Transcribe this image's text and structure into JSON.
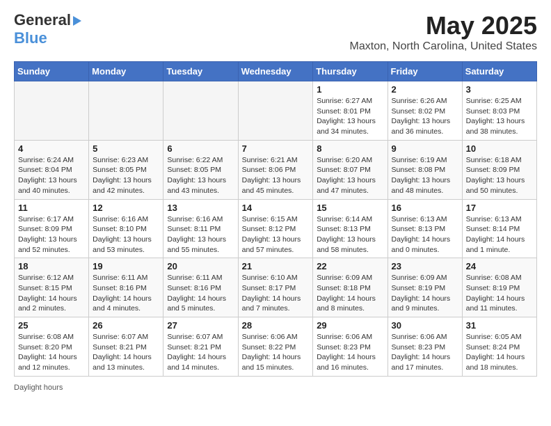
{
  "header": {
    "logo_line1": "General",
    "logo_line2": "Blue",
    "title": "May 2025",
    "location": "Maxton, North Carolina, United States"
  },
  "calendar": {
    "days_of_week": [
      "Sunday",
      "Monday",
      "Tuesday",
      "Wednesday",
      "Thursday",
      "Friday",
      "Saturday"
    ],
    "weeks": [
      [
        {
          "day": "",
          "detail": ""
        },
        {
          "day": "",
          "detail": ""
        },
        {
          "day": "",
          "detail": ""
        },
        {
          "day": "",
          "detail": ""
        },
        {
          "day": "1",
          "detail": "Sunrise: 6:27 AM\nSunset: 8:01 PM\nDaylight: 13 hours\nand 34 minutes."
        },
        {
          "day": "2",
          "detail": "Sunrise: 6:26 AM\nSunset: 8:02 PM\nDaylight: 13 hours\nand 36 minutes."
        },
        {
          "day": "3",
          "detail": "Sunrise: 6:25 AM\nSunset: 8:03 PM\nDaylight: 13 hours\nand 38 minutes."
        }
      ],
      [
        {
          "day": "4",
          "detail": "Sunrise: 6:24 AM\nSunset: 8:04 PM\nDaylight: 13 hours\nand 40 minutes."
        },
        {
          "day": "5",
          "detail": "Sunrise: 6:23 AM\nSunset: 8:05 PM\nDaylight: 13 hours\nand 42 minutes."
        },
        {
          "day": "6",
          "detail": "Sunrise: 6:22 AM\nSunset: 8:05 PM\nDaylight: 13 hours\nand 43 minutes."
        },
        {
          "day": "7",
          "detail": "Sunrise: 6:21 AM\nSunset: 8:06 PM\nDaylight: 13 hours\nand 45 minutes."
        },
        {
          "day": "8",
          "detail": "Sunrise: 6:20 AM\nSunset: 8:07 PM\nDaylight: 13 hours\nand 47 minutes."
        },
        {
          "day": "9",
          "detail": "Sunrise: 6:19 AM\nSunset: 8:08 PM\nDaylight: 13 hours\nand 48 minutes."
        },
        {
          "day": "10",
          "detail": "Sunrise: 6:18 AM\nSunset: 8:09 PM\nDaylight: 13 hours\nand 50 minutes."
        }
      ],
      [
        {
          "day": "11",
          "detail": "Sunrise: 6:17 AM\nSunset: 8:09 PM\nDaylight: 13 hours\nand 52 minutes."
        },
        {
          "day": "12",
          "detail": "Sunrise: 6:16 AM\nSunset: 8:10 PM\nDaylight: 13 hours\nand 53 minutes."
        },
        {
          "day": "13",
          "detail": "Sunrise: 6:16 AM\nSunset: 8:11 PM\nDaylight: 13 hours\nand 55 minutes."
        },
        {
          "day": "14",
          "detail": "Sunrise: 6:15 AM\nSunset: 8:12 PM\nDaylight: 13 hours\nand 57 minutes."
        },
        {
          "day": "15",
          "detail": "Sunrise: 6:14 AM\nSunset: 8:13 PM\nDaylight: 13 hours\nand 58 minutes."
        },
        {
          "day": "16",
          "detail": "Sunrise: 6:13 AM\nSunset: 8:13 PM\nDaylight: 14 hours\nand 0 minutes."
        },
        {
          "day": "17",
          "detail": "Sunrise: 6:13 AM\nSunset: 8:14 PM\nDaylight: 14 hours\nand 1 minute."
        }
      ],
      [
        {
          "day": "18",
          "detail": "Sunrise: 6:12 AM\nSunset: 8:15 PM\nDaylight: 14 hours\nand 2 minutes."
        },
        {
          "day": "19",
          "detail": "Sunrise: 6:11 AM\nSunset: 8:16 PM\nDaylight: 14 hours\nand 4 minutes."
        },
        {
          "day": "20",
          "detail": "Sunrise: 6:11 AM\nSunset: 8:16 PM\nDaylight: 14 hours\nand 5 minutes."
        },
        {
          "day": "21",
          "detail": "Sunrise: 6:10 AM\nSunset: 8:17 PM\nDaylight: 14 hours\nand 7 minutes."
        },
        {
          "day": "22",
          "detail": "Sunrise: 6:09 AM\nSunset: 8:18 PM\nDaylight: 14 hours\nand 8 minutes."
        },
        {
          "day": "23",
          "detail": "Sunrise: 6:09 AM\nSunset: 8:19 PM\nDaylight: 14 hours\nand 9 minutes."
        },
        {
          "day": "24",
          "detail": "Sunrise: 6:08 AM\nSunset: 8:19 PM\nDaylight: 14 hours\nand 11 minutes."
        }
      ],
      [
        {
          "day": "25",
          "detail": "Sunrise: 6:08 AM\nSunset: 8:20 PM\nDaylight: 14 hours\nand 12 minutes."
        },
        {
          "day": "26",
          "detail": "Sunrise: 6:07 AM\nSunset: 8:21 PM\nDaylight: 14 hours\nand 13 minutes."
        },
        {
          "day": "27",
          "detail": "Sunrise: 6:07 AM\nSunset: 8:21 PM\nDaylight: 14 hours\nand 14 minutes."
        },
        {
          "day": "28",
          "detail": "Sunrise: 6:06 AM\nSunset: 8:22 PM\nDaylight: 14 hours\nand 15 minutes."
        },
        {
          "day": "29",
          "detail": "Sunrise: 6:06 AM\nSunset: 8:23 PM\nDaylight: 14 hours\nand 16 minutes."
        },
        {
          "day": "30",
          "detail": "Sunrise: 6:06 AM\nSunset: 8:23 PM\nDaylight: 14 hours\nand 17 minutes."
        },
        {
          "day": "31",
          "detail": "Sunrise: 6:05 AM\nSunset: 8:24 PM\nDaylight: 14 hours\nand 18 minutes."
        }
      ]
    ]
  },
  "footer": {
    "label": "Daylight hours"
  }
}
